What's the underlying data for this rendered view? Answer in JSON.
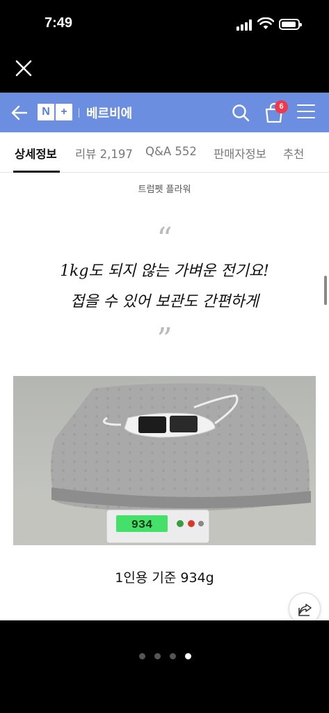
{
  "status_bar": {
    "time": "7:49"
  },
  "header": {
    "logo_n": "N",
    "logo_plus": "+",
    "store_name": "베르비에",
    "cart_count": "6"
  },
  "tabs": [
    {
      "label": "상세정보",
      "active": true
    },
    {
      "label": "리뷰 2,197"
    },
    {
      "label": "Q&A 552"
    },
    {
      "label": "판매자정보"
    },
    {
      "label": "추천"
    }
  ],
  "content": {
    "subtitle": "트럼펫 플라워",
    "quote_open": "“",
    "headline_line1": "1kg도 되지 않는 가벼운 전기요!",
    "headline_line2": "접을 수 있어 보관도 간편하게",
    "quote_close": "”",
    "scale_reading": "934",
    "caption": "1인용 기준 934g"
  },
  "pager": {
    "total": 4,
    "active_index": 3
  },
  "colors": {
    "header_bg": "#6b8ee0",
    "badge": "#f0394a",
    "scale_display": "#44e06a"
  }
}
